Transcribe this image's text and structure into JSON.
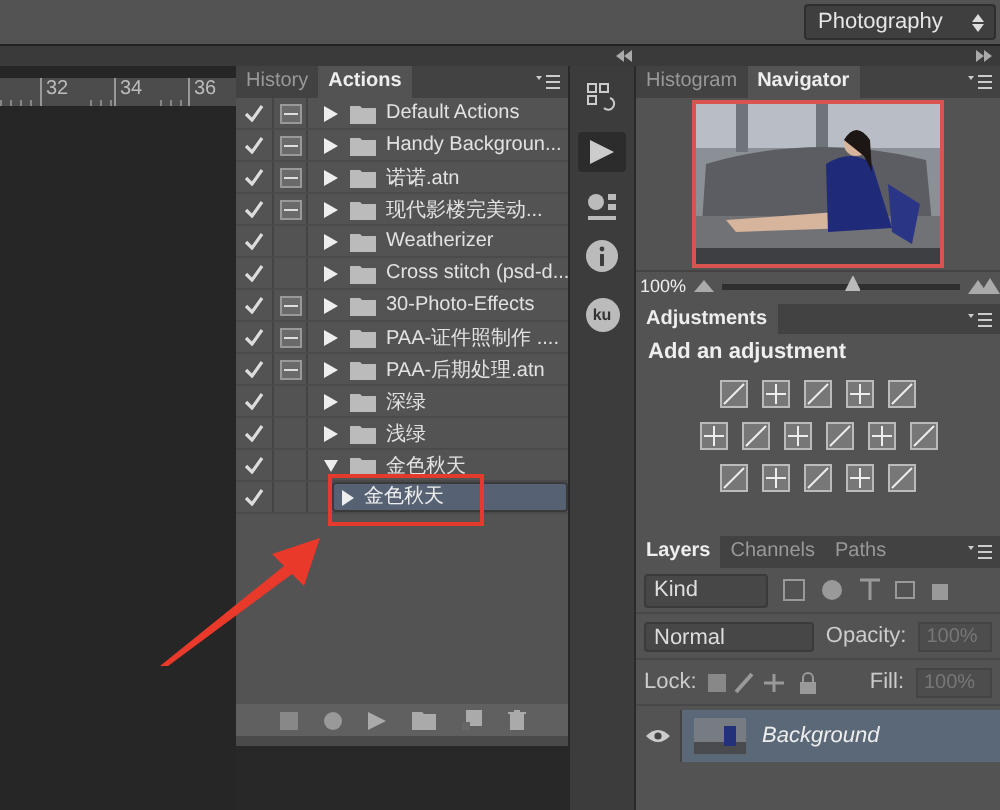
{
  "workspace": {
    "label": "Photography"
  },
  "ruler": {
    "ticks": [
      "32",
      "34",
      "36"
    ]
  },
  "actions_panel": {
    "tabs": [
      {
        "label": "History",
        "selected": false
      },
      {
        "label": "Actions",
        "selected": true
      }
    ],
    "sets": [
      {
        "name": "Default Actions",
        "enabled": true,
        "dialog": true,
        "expanded": false
      },
      {
        "name": "Handy Backgroun...",
        "enabled": true,
        "dialog": true,
        "expanded": false
      },
      {
        "name": "诺诺.atn",
        "enabled": true,
        "dialog": true,
        "expanded": false
      },
      {
        "name": "现代影楼完美动...",
        "enabled": true,
        "dialog": true,
        "expanded": false
      },
      {
        "name": "Weatherizer",
        "enabled": true,
        "dialog": false,
        "expanded": false
      },
      {
        "name": "Cross stitch (psd-d...",
        "enabled": true,
        "dialog": false,
        "expanded": false
      },
      {
        "name": "30-Photo-Effects",
        "enabled": true,
        "dialog": true,
        "expanded": false
      },
      {
        "name": "PAA-证件照制作 ....",
        "enabled": true,
        "dialog": true,
        "expanded": false
      },
      {
        "name": "PAA-后期处理.atn",
        "enabled": true,
        "dialog": true,
        "expanded": false
      },
      {
        "name": "深绿",
        "enabled": true,
        "dialog": false,
        "expanded": false
      },
      {
        "name": "浅绿",
        "enabled": true,
        "dialog": false,
        "expanded": false
      },
      {
        "name": "金色秋天",
        "enabled": true,
        "dialog": false,
        "expanded": true,
        "children": [
          {
            "name": "金色秋天",
            "enabled": true,
            "dialog": false,
            "selected": true
          }
        ]
      }
    ]
  },
  "dock": {
    "badge": "ku"
  },
  "navigator_panel": {
    "tabs": [
      {
        "label": "Histogram",
        "selected": false
      },
      {
        "label": "Navigator",
        "selected": true
      }
    ],
    "zoom": "100%",
    "zoom_slider": {
      "level": 0.55
    }
  },
  "adjustments_panel": {
    "title": "Adjustments",
    "heading": "Add an adjustment"
  },
  "layers_panel": {
    "tabs": [
      {
        "label": "Layers",
        "selected": true
      },
      {
        "label": "Channels",
        "selected": false
      },
      {
        "label": "Paths",
        "selected": false
      }
    ],
    "filter": "Kind",
    "blend_mode": "Normal",
    "opacity_label": "Opacity:",
    "opacity": "100%",
    "lock_label": "Lock:",
    "fill_label": "Fill:",
    "fill": "100%",
    "layers": [
      {
        "name": "Background",
        "visible": true
      }
    ]
  }
}
